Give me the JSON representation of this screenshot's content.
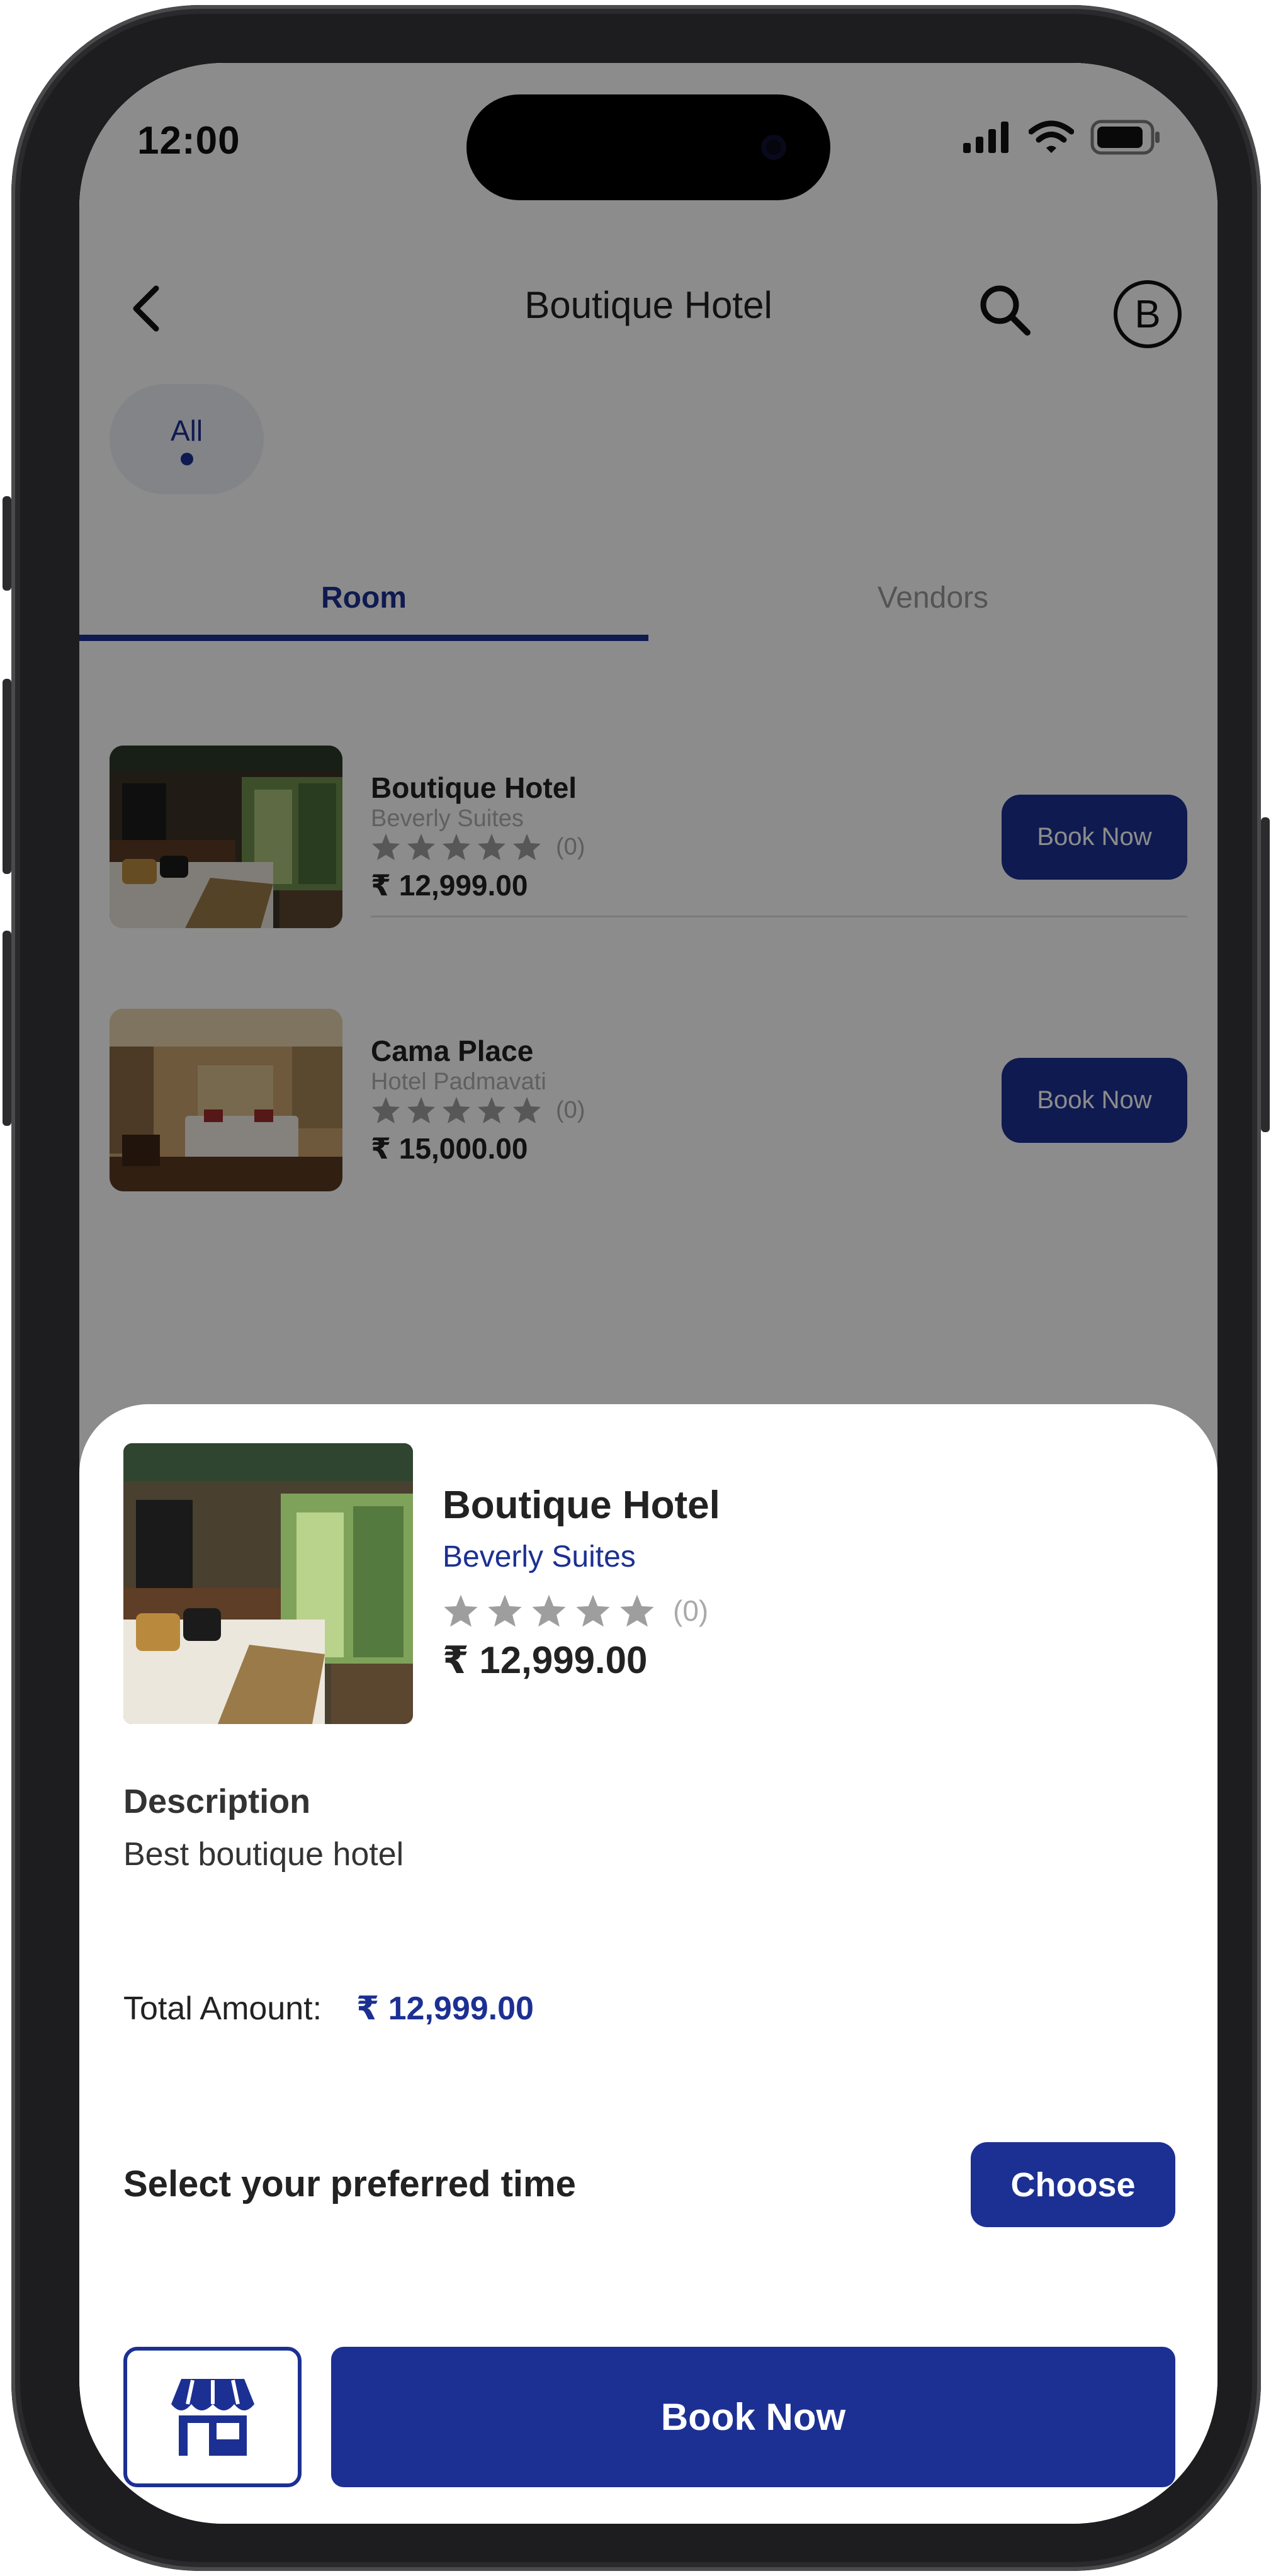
{
  "status_bar": {
    "time": "12:00"
  },
  "header": {
    "title": "Boutique Hotel",
    "avatar_letter": "B"
  },
  "filter_chips": [
    {
      "label": "All",
      "selected": true
    }
  ],
  "tabs": [
    {
      "label": "Room",
      "active": true
    },
    {
      "label": "Vendors",
      "active": false
    }
  ],
  "rooms": [
    {
      "name": "Boutique Hotel",
      "vendor": "Beverly Suites",
      "rating_count": "(0)",
      "stars": 0,
      "price": "₹ 12,999.00",
      "button": "Book Now"
    },
    {
      "name": "Cama Place",
      "vendor": "Hotel Padmavati",
      "rating_count": "(0)",
      "stars": 0,
      "price": "₹ 15,000.00",
      "button": "Book Now"
    }
  ],
  "sheet": {
    "title": "Boutique Hotel",
    "vendor": "Beverly Suites",
    "rating_count": "(0)",
    "price": "₹ 12,999.00",
    "description_heading": "Description",
    "description": "Best boutique hotel",
    "total_label": "Total Amount:",
    "total_value": "₹ 12,999.00",
    "time_label": "Select your preferred time",
    "choose_label": "Choose",
    "book_label": "Book Now",
    "store_icon": "store-icon"
  },
  "colors": {
    "accent": "#1c3093",
    "overlay": "rgba(0,0,0,0.45)",
    "star": "#9e9e9e"
  }
}
